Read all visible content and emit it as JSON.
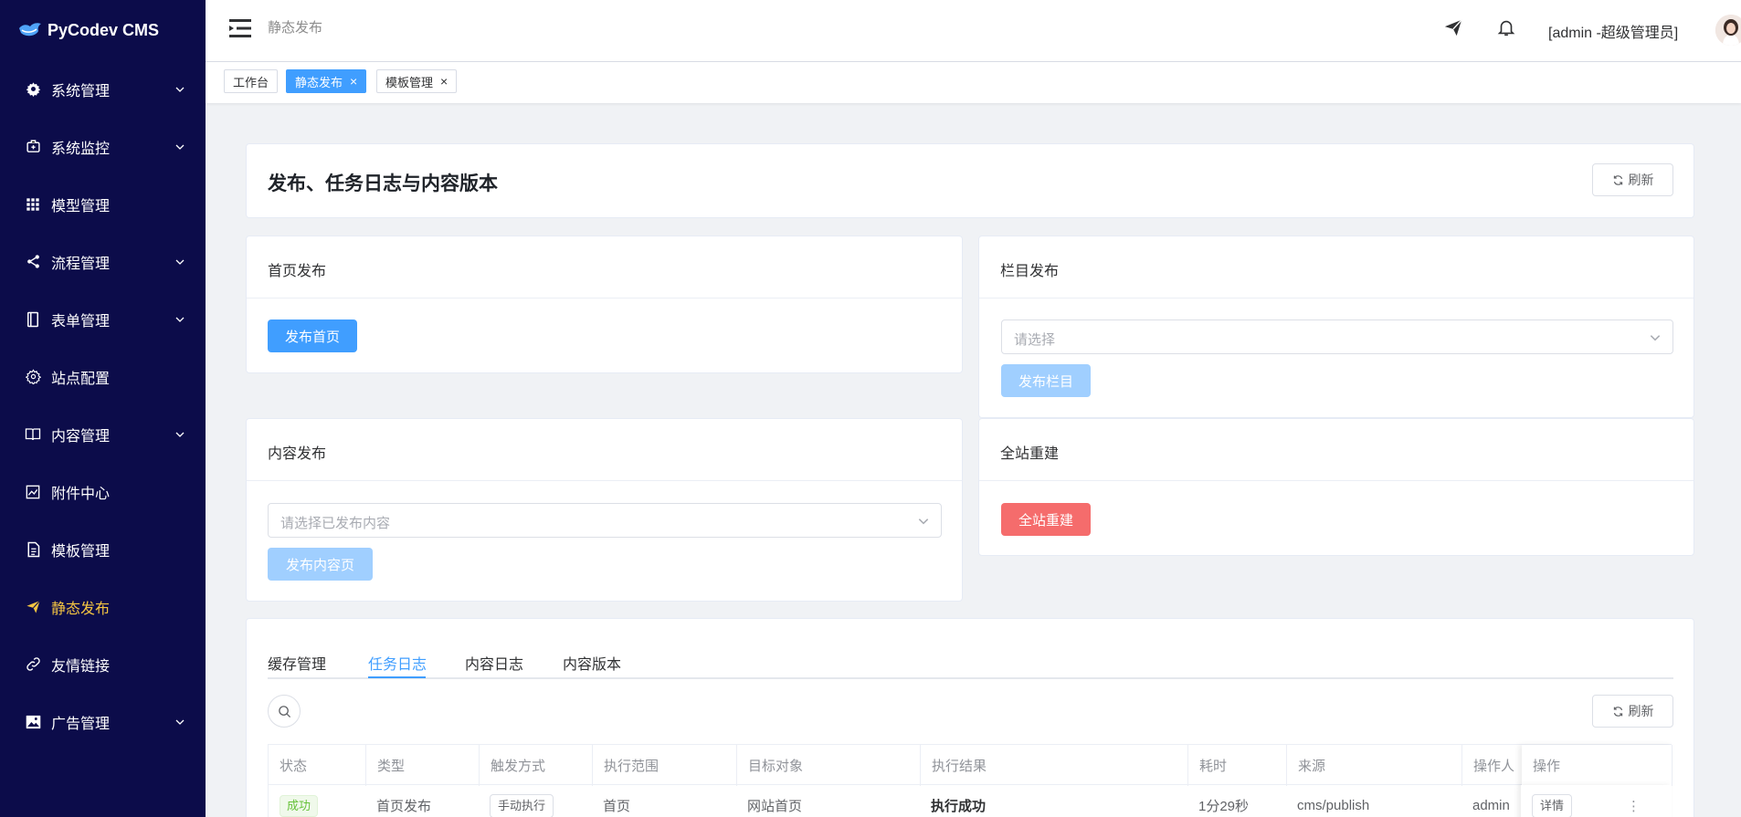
{
  "app": {
    "title": "PyCodev CMS"
  },
  "sidebar": {
    "items": [
      {
        "label": "系统管理",
        "icon": "gear-icon",
        "expandable": true
      },
      {
        "label": "系统监控",
        "icon": "monitor-icon",
        "expandable": true
      },
      {
        "label": "模型管理",
        "icon": "grid-icon",
        "expandable": false
      },
      {
        "label": "流程管理",
        "icon": "share-icon",
        "expandable": true
      },
      {
        "label": "表单管理",
        "icon": "notebook-icon",
        "expandable": true
      },
      {
        "label": "站点配置",
        "icon": "settings-icon",
        "expandable": false
      },
      {
        "label": "内容管理",
        "icon": "book-icon",
        "expandable": true
      },
      {
        "label": "附件中心",
        "icon": "chart-icon",
        "expandable": false
      },
      {
        "label": "模板管理",
        "icon": "document-icon",
        "expandable": false
      },
      {
        "label": "静态发布",
        "icon": "send-icon",
        "expandable": false,
        "active": true
      },
      {
        "label": "友情链接",
        "icon": "link-icon",
        "expandable": false
      },
      {
        "label": "广告管理",
        "icon": "picture-icon",
        "expandable": true
      }
    ]
  },
  "header": {
    "breadcrumb": "静态发布",
    "user": "[admin -超级管理员]"
  },
  "tags": [
    {
      "label": "工作台",
      "active": false,
      "closable": false
    },
    {
      "label": "静态发布",
      "active": true,
      "closable": true
    },
    {
      "label": "模板管理",
      "active": false,
      "closable": true
    }
  ],
  "page": {
    "title": "发布、任务日志与内容版本",
    "refresh_label": "刷新"
  },
  "home_publish": {
    "title": "首页发布",
    "button": "发布首页"
  },
  "column_publish": {
    "title": "栏目发布",
    "placeholder": "请选择",
    "button": "发布栏目"
  },
  "content_publish": {
    "title": "内容发布",
    "placeholder": "请选择已发布内容",
    "button": "发布内容页"
  },
  "rebuild": {
    "title": "全站重建",
    "button": "全站重建"
  },
  "logs": {
    "tabs": [
      "缓存管理",
      "任务日志",
      "内容日志",
      "内容版本"
    ],
    "active_tab": "任务日志",
    "refresh_label": "刷新",
    "columns": [
      "状态",
      "类型",
      "触发方式",
      "执行范围",
      "目标对象",
      "执行结果",
      "耗时",
      "来源",
      "操作人",
      "操作"
    ],
    "rows": [
      {
        "status": "成功",
        "type": "首页发布",
        "trigger": "手动执行",
        "scope": "首页",
        "target": "网站首页",
        "result": "执行成功",
        "duration": "1分29秒",
        "source": "cms/publish",
        "operator": "admin",
        "action": "详情"
      }
    ]
  },
  "colors": {
    "sidebar_bg": "#0c0c4a",
    "active_menu": "#f5c542",
    "primary": "#409eff",
    "danger": "#f56c6c",
    "success": "#67c23a"
  }
}
